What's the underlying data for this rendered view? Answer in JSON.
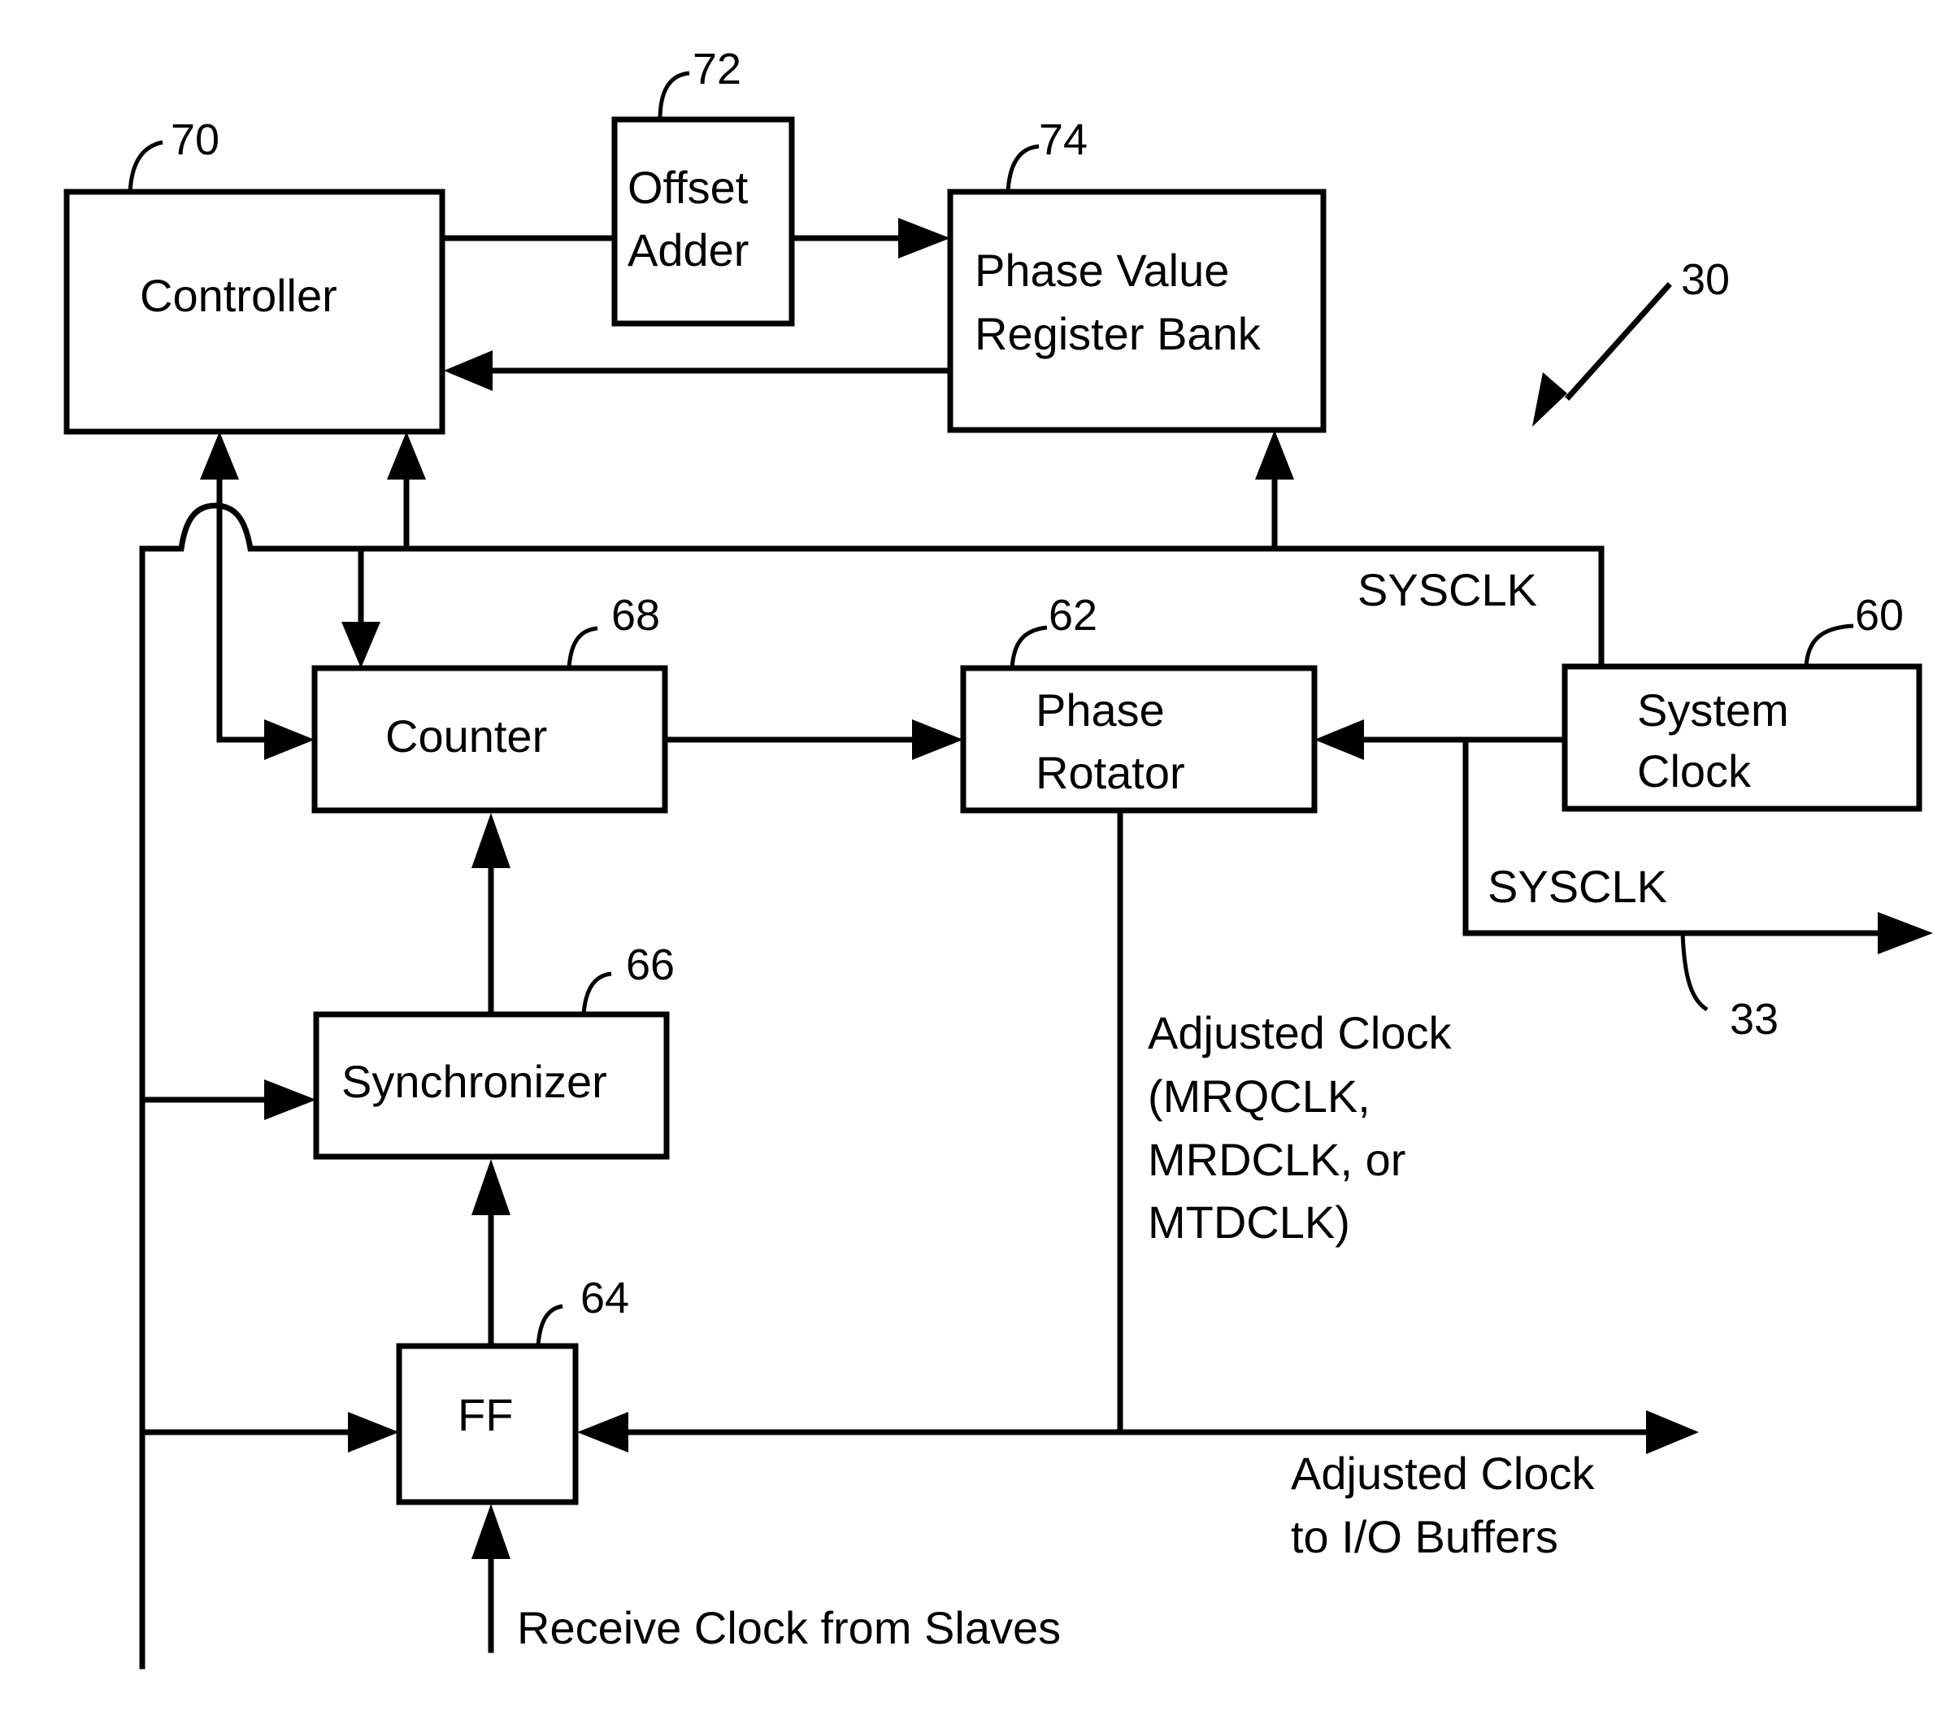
{
  "figure": {
    "reference": "30",
    "blocks": {
      "controller": {
        "label": "Controller",
        "ref": "70"
      },
      "offset_adder": {
        "label_lines": [
          "Offset",
          "Adder"
        ],
        "ref": "72"
      },
      "phase_value_register_bank": {
        "label_lines": [
          "Phase Value",
          "Register Bank"
        ],
        "ref": "74"
      },
      "counter": {
        "label": "Counter",
        "ref": "68"
      },
      "phase_rotator": {
        "label_lines": [
          "Phase",
          "Rotator"
        ],
        "ref": "62"
      },
      "system_clock": {
        "label_lines": [
          "System",
          "Clock"
        ],
        "ref": "60"
      },
      "synchronizer": {
        "label": "Synchronizer",
        "ref": "66"
      },
      "ff": {
        "label": "FF",
        "ref": "64"
      }
    },
    "signals": {
      "sysclk_bus": "SYSCLK",
      "sysclk_out": "SYSCLK",
      "sysclk_out_ref": "33",
      "adjusted_clock_lines": [
        "Adjusted Clock",
        "(MRQCLK,",
        "MRDCLK, or",
        "MTDCLK)"
      ],
      "adjusted_to_io_lines": [
        "Adjusted Clock",
        "to I/O Buffers"
      ],
      "receive_clock": "Receive Clock from Slaves"
    }
  }
}
